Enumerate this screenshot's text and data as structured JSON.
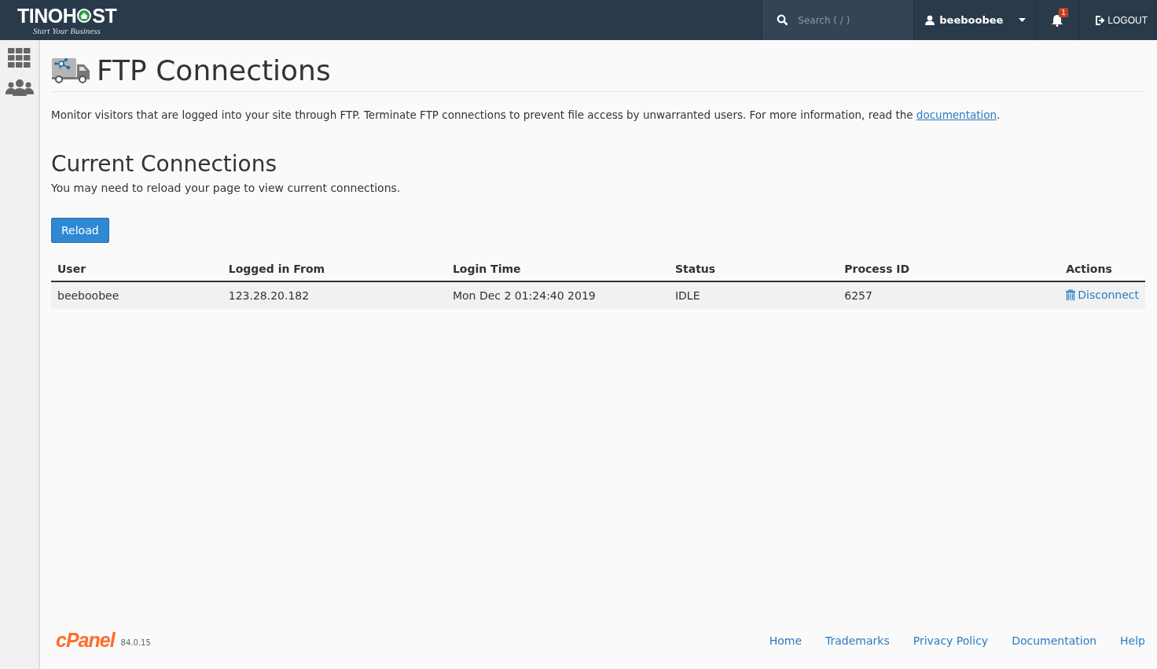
{
  "header": {
    "logo_left": "TINOH",
    "logo_right": "ST",
    "tagline": "Start Your Business",
    "search": {
      "placeholder": "Search ( / )"
    },
    "user": "beeboobee",
    "notifications": "1",
    "logout": "LOGOUT"
  },
  "sidebar": {
    "items": [
      {
        "kind": "grid"
      },
      {
        "kind": "users"
      }
    ]
  },
  "page": {
    "title": "FTP Connections",
    "intro": "Monitor visitors that are logged into your site through FTP. Terminate FTP connections to prevent file access by unwarranted users. For more information, read the ",
    "link": "documentation",
    "intro_end": ".",
    "section_title": "Current Connections",
    "section_note": "You may need to reload your page to view current connections.",
    "reload": "Reload"
  },
  "table": {
    "columns": [
      "User",
      "Logged in From",
      "Login Time",
      "Status",
      "Process ID",
      "Actions"
    ],
    "rows": [
      {
        "cells": [
          "beeboobee",
          "123.28.20.182",
          "Mon Dec 2 01:24:40 2019",
          "IDLE",
          "6257"
        ],
        "action": "Disconnect"
      }
    ]
  },
  "footer": {
    "brand": "cPanel",
    "version": "84.0.15",
    "links": [
      "Home",
      "Trademarks",
      "Privacy Policy",
      "Documentation",
      "Help"
    ]
  }
}
